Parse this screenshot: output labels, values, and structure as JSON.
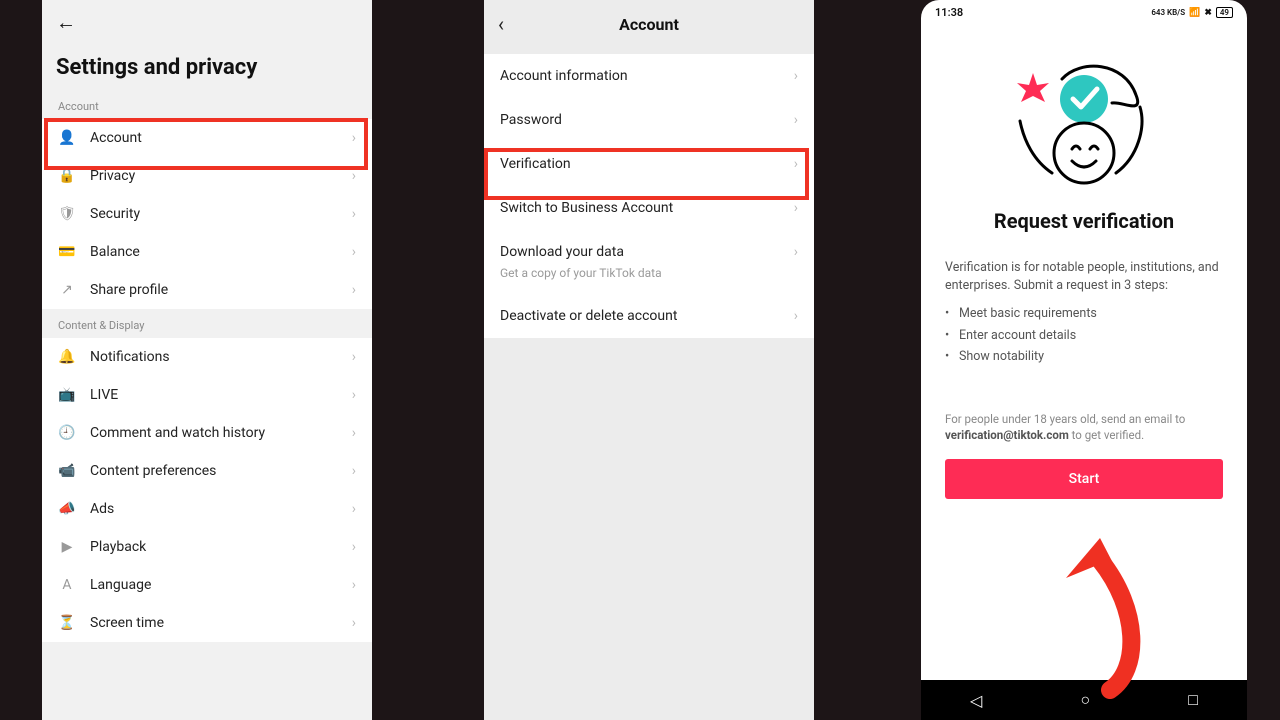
{
  "phone1": {
    "title": "Settings and privacy",
    "section_account": "Account",
    "section_content": "Content & Display",
    "items_account": [
      {
        "label": "Account",
        "icon": "👤"
      },
      {
        "label": "Privacy",
        "icon": "🔒"
      },
      {
        "label": "Security",
        "icon": "🛡"
      },
      {
        "label": "Balance",
        "icon": "💳"
      },
      {
        "label": "Share profile",
        "icon": "↗"
      }
    ],
    "items_content": [
      {
        "label": "Notifications",
        "icon": "🔔"
      },
      {
        "label": "LIVE",
        "icon": "📺"
      },
      {
        "label": "Comment and watch history",
        "icon": "🕘"
      },
      {
        "label": "Content preferences",
        "icon": "📹"
      },
      {
        "label": "Ads",
        "icon": "📣"
      },
      {
        "label": "Playback",
        "icon": "▶"
      },
      {
        "label": "Language",
        "icon": "A"
      },
      {
        "label": "Screen time",
        "icon": "⏳"
      }
    ]
  },
  "phone2": {
    "title": "Account",
    "items": [
      {
        "label": "Account information"
      },
      {
        "label": "Password"
      },
      {
        "label": "Verification"
      },
      {
        "label": "Switch to Business Account"
      },
      {
        "label": "Download your data",
        "sub": "Get a copy of your TikTok data"
      },
      {
        "label": "Deactivate or delete account"
      }
    ]
  },
  "phone3": {
    "status_time": "11:38",
    "status_kbs": "643 KB/S",
    "status_batt": "49",
    "title": "Request verification",
    "desc": "Verification is for notable people, institutions, and enterprises. Submit a request in 3 steps:",
    "steps": [
      "Meet basic requirements",
      "Enter account details",
      "Show notability"
    ],
    "under18_pre": "For people under 18 years old, send an email to ",
    "under18_email": "verification@tiktok.com",
    "under18_post": " to get verified.",
    "start": "Start"
  }
}
